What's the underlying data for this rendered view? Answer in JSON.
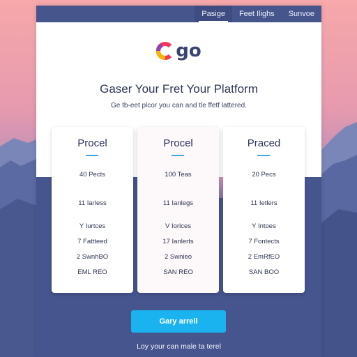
{
  "nav": {
    "items": [
      {
        "label": "Pasige",
        "active": true
      },
      {
        "label": "Feet Ilighs",
        "active": false
      },
      {
        "label": "Sunvoe",
        "active": false
      }
    ]
  },
  "logo": {
    "text": "go",
    "colors": [
      "#f5365c",
      "#f7b500",
      "#8e44ad"
    ]
  },
  "hero": {
    "headline": "Gaser Your Fret Your Platform",
    "subline": "Ge tb-eet plcor you can and tle ffetf lattered."
  },
  "plans": [
    {
      "title": "Procel",
      "features": [
        "40 Pects",
        "11 Iarless",
        "Y Iurtces",
        "7 Fattteed",
        "2 SwnhBO",
        "EML REO"
      ]
    },
    {
      "title": "Procel",
      "features": [
        "100 Teas",
        "11 Ianlegs",
        "V Iorlces",
        "17 Ianlerts",
        "2 Swnieo",
        "SAN REO"
      ]
    },
    {
      "title": "Praced",
      "features": [
        "20 Pecs",
        "11 Ietlers",
        "Y Intoes",
        "7 Fontects",
        "2 EmRfEO",
        "SAN BOO"
      ]
    }
  ],
  "cta": {
    "label": "Gary arrell"
  },
  "footer": {
    "text": "Loy your can male ta terel"
  },
  "theme": {
    "nav_bg": "#47558d",
    "accent": "#1ab3ef",
    "dark_band": "#46558e"
  }
}
